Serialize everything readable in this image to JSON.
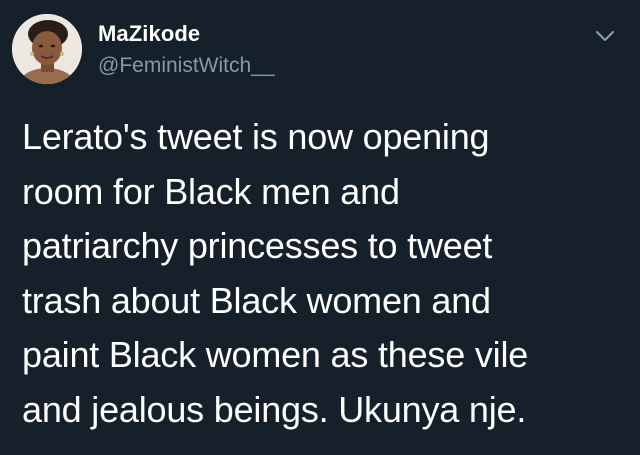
{
  "tweet": {
    "display_name": "MaZikode",
    "handle": "@FeministWitch__",
    "text": "Lerato's tweet is now opening\nroom for Black men and\npatriarchy princesses to tweet\ntrash about Black women and\npaint Black women as these vile\nand jealous beings. Ukunya nje.",
    "avatar_icon": "profile-photo",
    "menu_icon": "chevron-down-icon"
  },
  "colors": {
    "background": "#15202b",
    "primary_text": "#ffffff",
    "secondary_text": "#8899a6"
  }
}
